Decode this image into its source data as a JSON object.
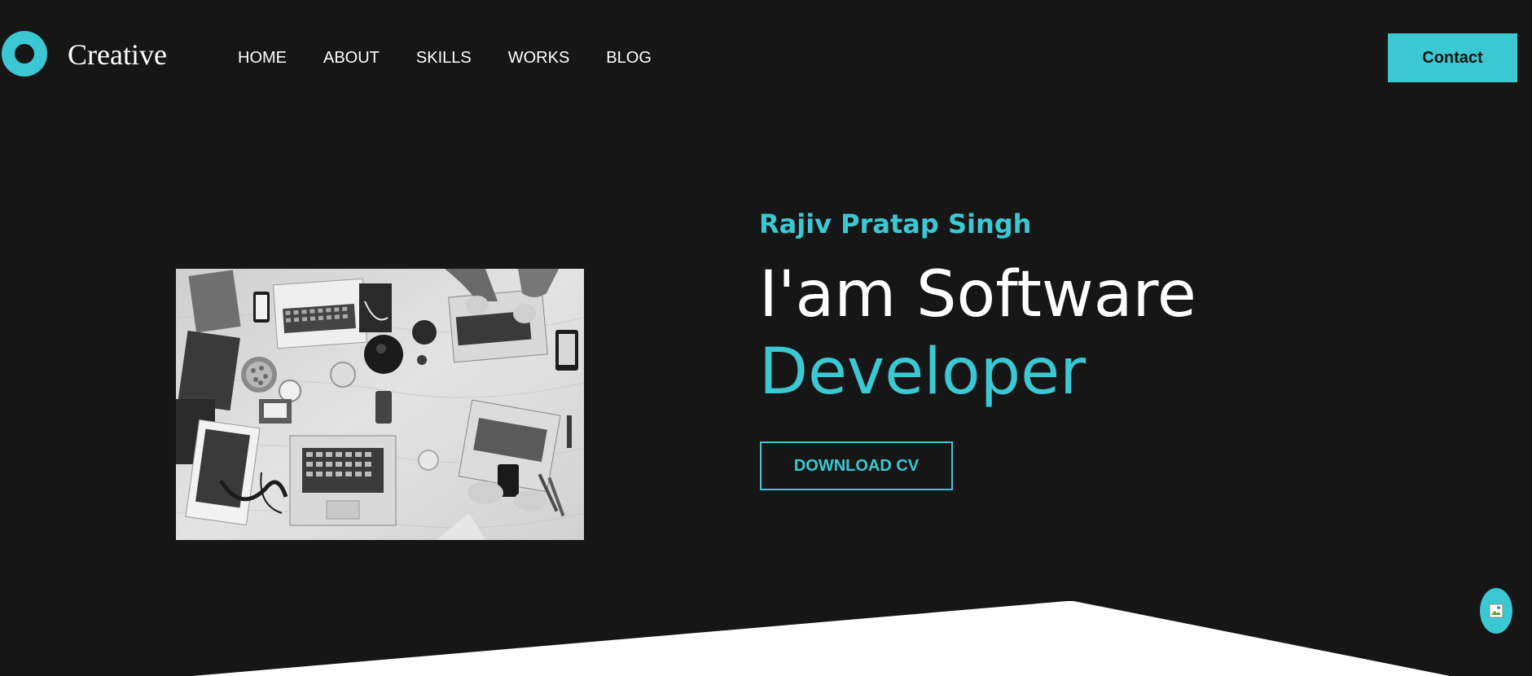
{
  "header": {
    "logo_text": "Creative",
    "nav": {
      "items": [
        {
          "label": "HOME"
        },
        {
          "label": "ABOUT"
        },
        {
          "label": "SKILLS"
        },
        {
          "label": "WORKS"
        },
        {
          "label": "BLOG"
        }
      ]
    },
    "contact_label": "Contact"
  },
  "hero": {
    "name": "Rajiv Pratap Singh",
    "headline_line1": "I'am Software",
    "headline_line2": "Developer",
    "download_label": "DOWNLOAD CV",
    "image_subject": "workspace-desk-laptops-grayscale"
  },
  "floating_button": {
    "icon": "broken-image-icon"
  },
  "colors": {
    "background": "#161616",
    "accent": "#3cc8d2",
    "text": "#ffffff",
    "bottom_shape": "#ffffff"
  }
}
